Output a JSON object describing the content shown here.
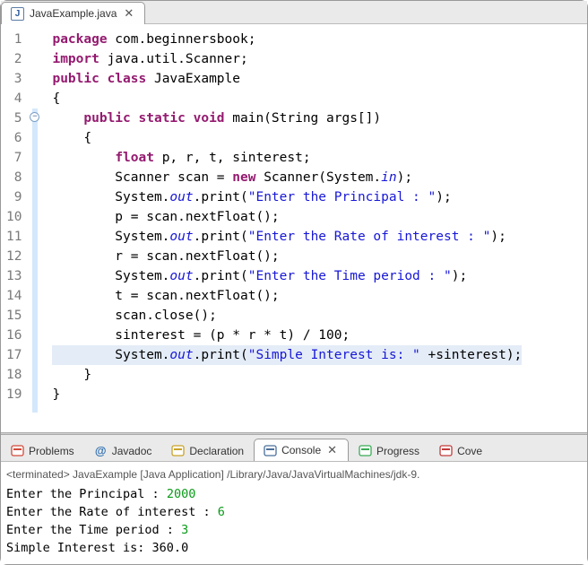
{
  "editor_tab": {
    "filename": "JavaExample.java",
    "icon_letter": "J",
    "close_glyph": "✕"
  },
  "code_lines": [
    {
      "n": 1,
      "html": "<span class='kw'>package</span> com.beginnersbook;"
    },
    {
      "n": 2,
      "html": "<span class='kw'>import</span> java.util.Scanner;"
    },
    {
      "n": 3,
      "html": "<span class='kw'>public class</span> JavaExample"
    },
    {
      "n": 4,
      "html": "{"
    },
    {
      "n": 5,
      "html": "    <span class='kw'>public static void</span> main(String args[])"
    },
    {
      "n": 6,
      "html": "    {"
    },
    {
      "n": 7,
      "html": "        <span class='kw'>float</span> p, r, t, sinterest;"
    },
    {
      "n": 8,
      "html": "        Scanner scan = <span class='kw'>new</span> Scanner(System.<span class='ital'>in</span>);"
    },
    {
      "n": 9,
      "html": "        System.<span class='ital'>out</span>.print(<span class='str'>\"Enter the Principal : \"</span>);"
    },
    {
      "n": 10,
      "html": "        p = scan.nextFloat();"
    },
    {
      "n": 11,
      "html": "        System.<span class='ital'>out</span>.print(<span class='str'>\"Enter the Rate of interest : \"</span>);"
    },
    {
      "n": 12,
      "html": "        r = scan.nextFloat();"
    },
    {
      "n": 13,
      "html": "        System.<span class='ital'>out</span>.print(<span class='str'>\"Enter the Time period : \"</span>);"
    },
    {
      "n": 14,
      "html": "        t = scan.nextFloat();"
    },
    {
      "n": 15,
      "html": "        scan.close();"
    },
    {
      "n": 16,
      "html": "        sinterest = (p * r * t) / 100;"
    },
    {
      "n": 17,
      "html": "        System.<span class='ital'>out</span>.print(<span class='str'>\"Simple Interest is: \"</span> +sinterest);",
      "highlight": true
    },
    {
      "n": 18,
      "html": "    }"
    },
    {
      "n": 19,
      "html": "}"
    }
  ],
  "bottom_tabs": [
    {
      "id": "problems",
      "label": "Problems",
      "icon_color": "#d04a3a",
      "active": false
    },
    {
      "id": "javadoc",
      "label": "Javadoc",
      "icon_color": "#2d6db0",
      "active": false,
      "icon_glyph": "@"
    },
    {
      "id": "declaration",
      "label": "Declaration",
      "icon_color": "#c9a227",
      "active": false
    },
    {
      "id": "console",
      "label": "Console",
      "icon_color": "#4a6f9b",
      "active": true,
      "closeable": true,
      "close_glyph": "✕"
    },
    {
      "id": "progress",
      "label": "Progress",
      "icon_color": "#3aaa56",
      "active": false
    },
    {
      "id": "coverage",
      "label": "Coverage",
      "icon_color": "#c23a3a",
      "active": false,
      "truncated": "Cove"
    }
  ],
  "console": {
    "status": "<terminated> JavaExample [Java Application] /Library/Java/JavaVirtualMachines/jdk-9.",
    "lines": [
      {
        "prompt": "Enter the Principal : ",
        "input": "2000"
      },
      {
        "prompt": "Enter the Rate of interest : ",
        "input": "6"
      },
      {
        "prompt": "Enter the Time period : ",
        "input": "3"
      },
      {
        "prompt": "Simple Interest is: 360.0",
        "input": ""
      }
    ]
  }
}
